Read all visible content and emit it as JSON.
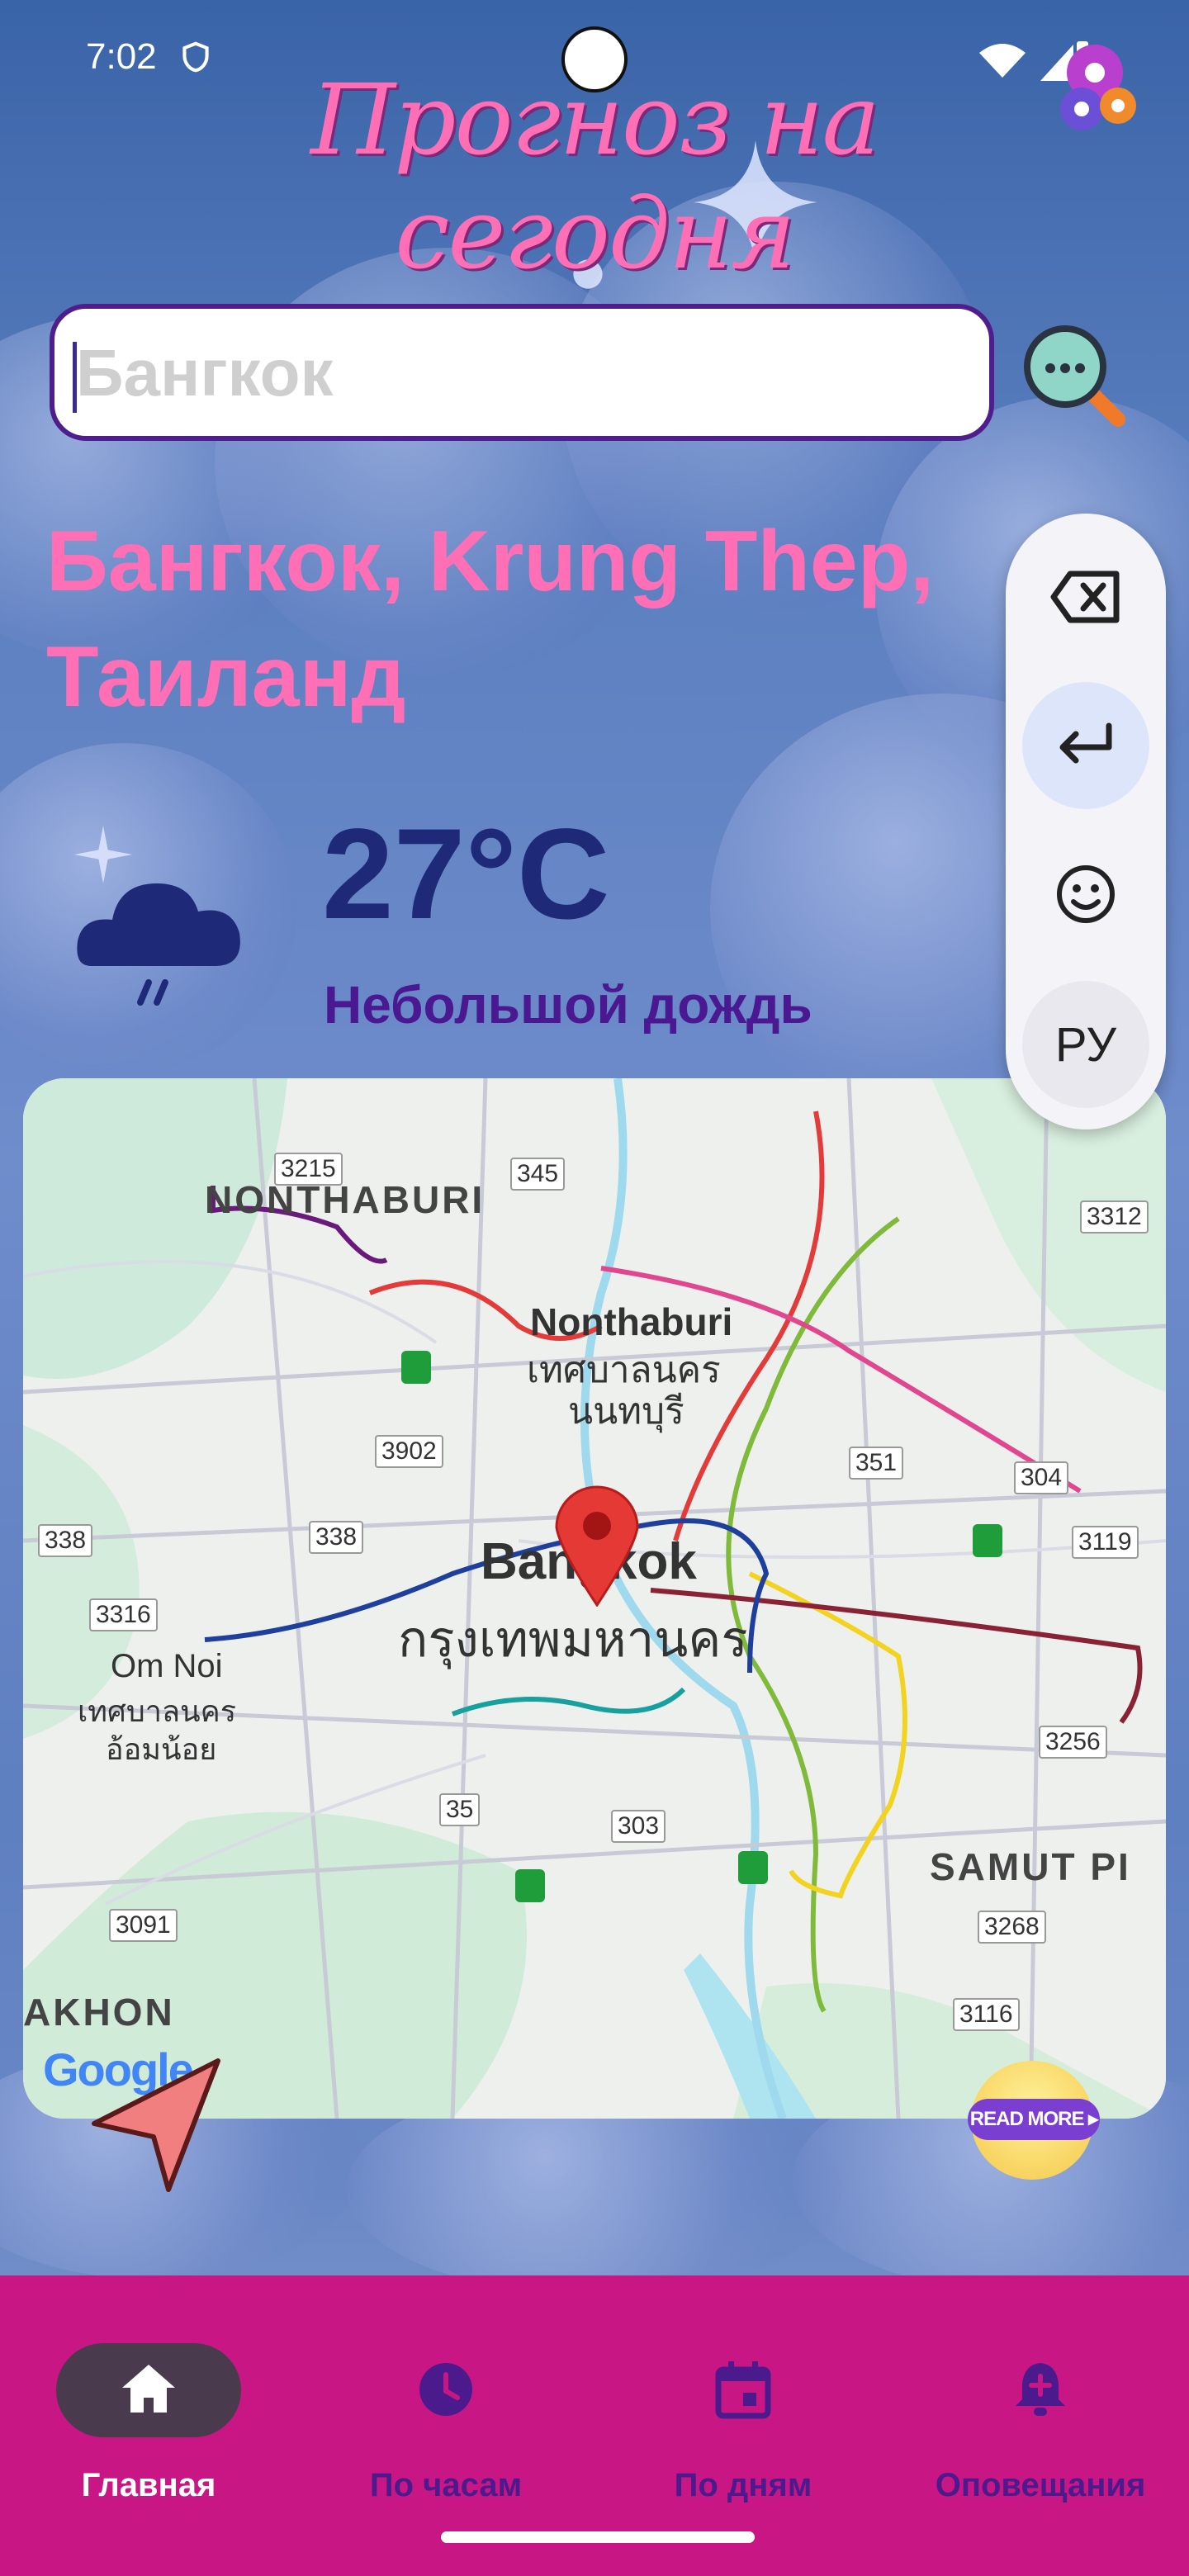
{
  "status": {
    "time": "7:02"
  },
  "header": {
    "title": "Прогноз на сегодня",
    "settings_icon": "gears-icon"
  },
  "search": {
    "value": "",
    "placeholder": "Бангкок",
    "button_icon": "magnifier-icon"
  },
  "location": {
    "name": "Бангкок, Krung Thep, Таиланд"
  },
  "weather": {
    "temperature": "27°C",
    "description": "Небольшой дождь",
    "icon": "rain-cloud-icon"
  },
  "keyboard_toolbar": {
    "items": [
      {
        "name": "backspace",
        "icon": "backspace-icon"
      },
      {
        "name": "enter",
        "icon": "enter-icon"
      },
      {
        "name": "emoji",
        "icon": "emoji-icon"
      },
      {
        "name": "language",
        "label": "РУ"
      }
    ]
  },
  "map": {
    "labels": {
      "nonthaburi_region": "NONTHABURI",
      "nonthaburi": "Nonthaburi",
      "nonthaburi_th1": "เทศบาลนคร",
      "nonthaburi_th2": "นนทบุรี",
      "bangkok": "Bangkok",
      "bangkok_th": "กรุงเทพมหานคร",
      "om_noi": "Om Noi",
      "om_noi_th1": "เทศบาลนคร",
      "om_noi_th2": "อ้อมน้อย",
      "samut": "SAMUT PI",
      "nakhon": "AKHON",
      "attribution": "Google"
    },
    "road_numbers": [
      "3215",
      "345",
      "3312",
      "3902",
      "351",
      "304",
      "338",
      "338",
      "3119",
      "3316",
      "3256",
      "35",
      "303",
      "3091",
      "3268",
      "3116"
    ],
    "read_more": "READ MORE ▸"
  },
  "nav": {
    "items": [
      {
        "label": "Главная",
        "icon": "home-icon",
        "active": true
      },
      {
        "label": "По часам",
        "icon": "clock-icon",
        "active": false
      },
      {
        "label": "По дням",
        "icon": "calendar-icon",
        "active": false
      },
      {
        "label": "Оповещания",
        "icon": "bell-plus-icon",
        "active": false
      }
    ]
  },
  "colors": {
    "accent": "#ff6fb5",
    "nav_bg": "#c81784",
    "temp": "#1e2a78",
    "desc": "#4a1890"
  }
}
